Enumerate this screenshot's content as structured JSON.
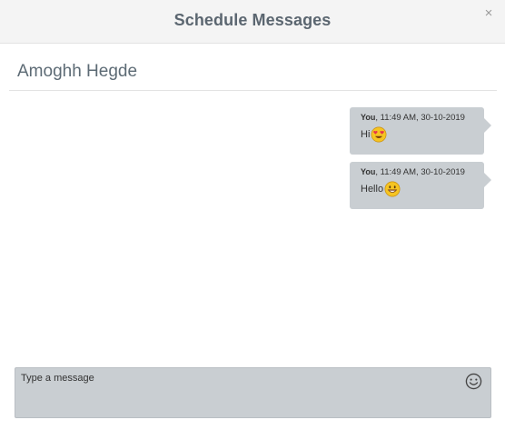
{
  "modal": {
    "title": "Schedule Messages",
    "close_label": "×"
  },
  "conversation": {
    "contact_name": "Amoghh Hegde",
    "messages": [
      {
        "sender": "You",
        "timestamp": ", 11:49 AM, 30-10-2019",
        "text": "Hi",
        "emoji": "heart-eyes-emoji"
      },
      {
        "sender": "You",
        "timestamp": ", 11:49 AM, 30-10-2019",
        "text": "Hello",
        "emoji": "grinning-emoji"
      }
    ]
  },
  "composer": {
    "placeholder": "Type a message",
    "value": "",
    "emoji_button_icon": "smiley-icon"
  },
  "colors": {
    "header_bg": "#f4f4f4",
    "bubble_bg": "#c9ced2",
    "title_text": "#5b6670",
    "emoji_yellow": "#f5c422",
    "heart_red": "#e8324b"
  }
}
